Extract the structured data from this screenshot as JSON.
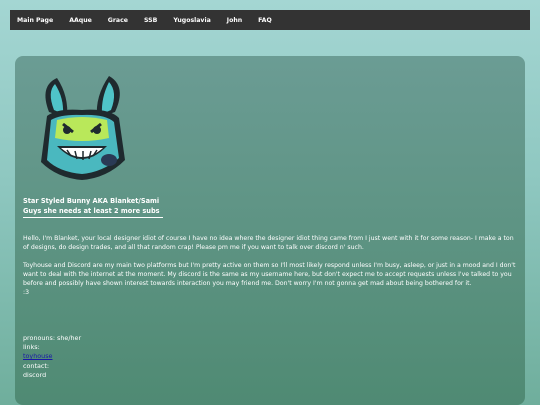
{
  "nav": {
    "items": [
      "Main Page",
      "AAque",
      "Grace",
      "SSB",
      "Yugoslavia",
      "John",
      "FAQ"
    ]
  },
  "profile": {
    "title": "Star Styled Bunny AKA Blanket/Sami",
    "subtitle": "Guys she needs at least 2 more subs",
    "bio_p1": "Hello, I'm Blanket, your local designer idiot of course I have no idea where the designer idiot thing came from I just went with it for some reason- I make a ton of designs, do design trades, and all that random crap! Please pm me if you want to talk over discord n' such.",
    "bio_p2": "Toyhouse and Discord are my main two platforms but I'm pretty active on them so I'll most likely respond unless I'm busy, asleep, or just in a mood and I don't want to deal with the internet at the moment. My discord is the same as my username here, but don't expect me to accept requests unless I've talked to you before and possibly have shown interest towards interaction you may friend me. Don't worry I'm not gonna get mad about being bothered for it.",
    "bio_p2_end": ":3",
    "pronouns": "pronouns: she/her",
    "links_label": "links:",
    "toyhouse_link": "toyhouse",
    "contact_label": "contact:",
    "contact_value": "discord"
  },
  "colors": {
    "navbar": "#333333",
    "panel": "#5b9280",
    "link": "#1a1aa6"
  },
  "icons": [
    "bunny-avatar-icon"
  ]
}
